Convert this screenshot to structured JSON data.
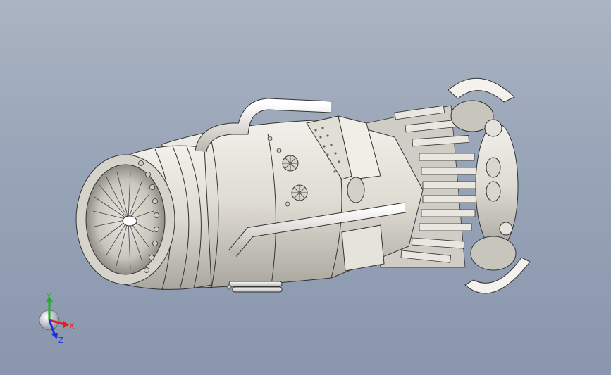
{
  "viewport": {
    "background_top": "#aab4c2",
    "background_bottom": "#8996ad",
    "model": "jet-engine-assembly",
    "render_style": "shaded-with-edges"
  },
  "triad": {
    "x_label": "X",
    "y_label": "Y",
    "z_label": "Z",
    "x_color": "#e02020",
    "y_color": "#20b020",
    "z_color": "#2030e0"
  }
}
